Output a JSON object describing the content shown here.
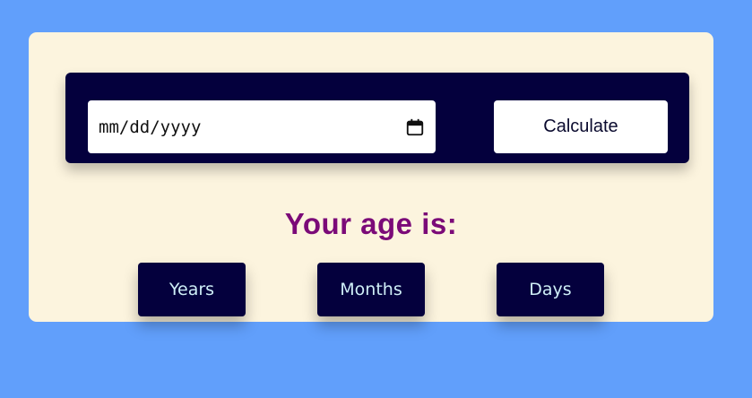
{
  "form": {
    "date_placeholder": "mm/dd/yyyy",
    "calculate_label": "Calculate",
    "calendar_icon": "calendar-icon"
  },
  "result": {
    "title": "Your age is:",
    "years_label": "Years",
    "months_label": "Months",
    "days_label": "Days"
  },
  "colors": {
    "background": "#619ffb",
    "card": "#fcf4de",
    "panel": "#04003d",
    "title": "#7b0a78",
    "result_text": "#cfeef7"
  }
}
